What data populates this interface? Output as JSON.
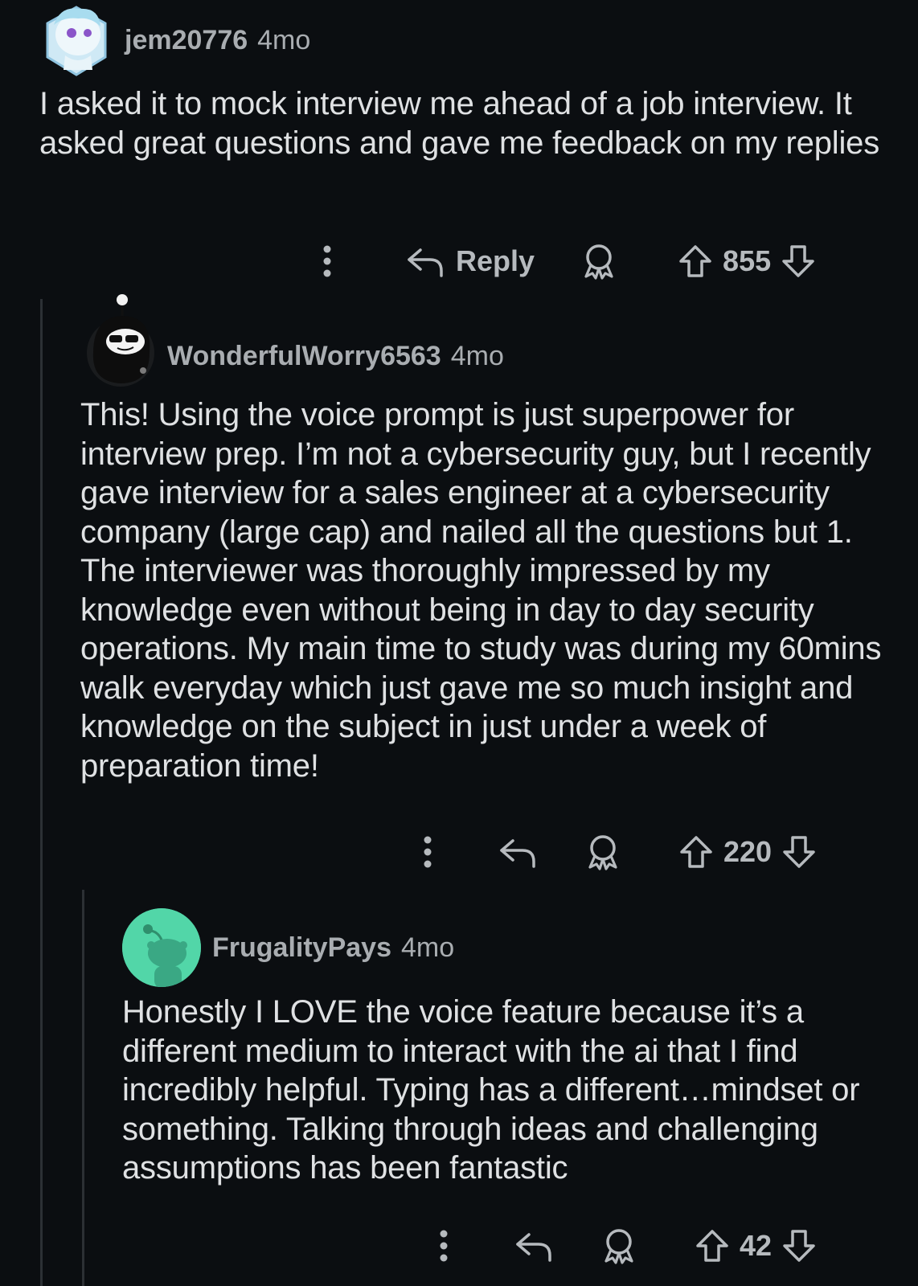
{
  "comments": [
    {
      "username": "jem20776",
      "age": "4mo",
      "avatar": "snoo-avatar-blue-white",
      "body": "I asked it to mock interview me ahead of a job interview. It asked great questions and gave me feedback on my replies",
      "reply_label": "Reply",
      "score": "855"
    },
    {
      "username": "WonderfulWorry6563",
      "age": "4mo",
      "avatar": "snoo-avatar-black-hood-sunglasses",
      "body": "This! Using the voice prompt is just superpower for interview prep. I’m not a cybersecurity guy, but I recently gave interview for a sales engineer at a cybersecurity company (large cap) and nailed all the questions but 1. The interviewer was thoroughly impressed by my knowledge even without being in day to day security operations. My main time to study was during my 60mins walk everyday which just gave me so much insight and knowledge on the subject in just under a week of preparation time!",
      "score": "220"
    },
    {
      "username": "FrugalityPays",
      "age": "4mo",
      "avatar": "default-snoo-avatar-mint",
      "body": "Honestly I LOVE the voice feature because it’s a different medium to interact with the ai that I find incredibly helpful. Typing has a different…mindset or something. Talking through ideas and challenging assumptions has been fantastic",
      "score": "42"
    }
  ],
  "icons": {
    "more": "more-options-icon",
    "reply": "reply-arrow-icon",
    "award": "award-icon",
    "upvote": "upvote-icon",
    "downvote": "downvote-icon"
  },
  "colors": {
    "background": "#0b0e11",
    "text": "#dfe1e3",
    "muted": "#a9adb1",
    "mint_avatar": "#52d6a8"
  }
}
